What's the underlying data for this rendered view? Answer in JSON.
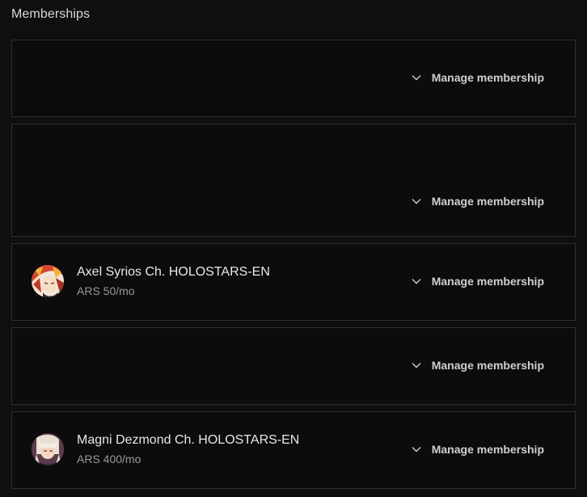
{
  "page": {
    "title": "Memberships"
  },
  "memberships": [
    {
      "name": "",
      "price": "",
      "manage_label": "Manage membership"
    },
    {
      "name": "",
      "price": "",
      "manage_label": "Manage membership"
    },
    {
      "name": "Axel Syrios Ch. HOLOSTARS-EN",
      "price": "ARS 50/mo",
      "manage_label": "Manage membership",
      "avatar_icon": "channel-avatar-axel"
    },
    {
      "name": "",
      "price": "",
      "manage_label": "Manage membership"
    },
    {
      "name": "Magni Dezmond Ch. HOLOSTARS-EN",
      "price": "ARS 400/mo",
      "manage_label": "Manage membership",
      "avatar_icon": "channel-avatar-magni"
    }
  ],
  "icons": {
    "expand": "chevron-down-icon"
  },
  "colors": {
    "background": "#0f0f0f",
    "card_border": "#303030",
    "text_primary": "#e8e8e8",
    "text_secondary": "#9a9a9a"
  }
}
